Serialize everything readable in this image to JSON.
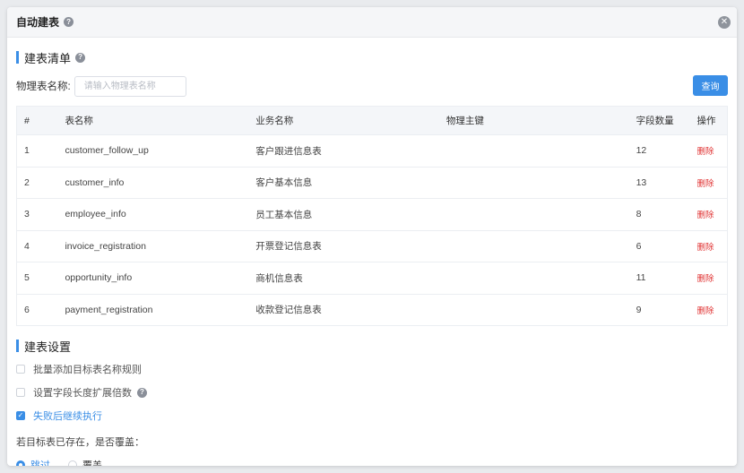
{
  "dialog": {
    "title": "自动建表",
    "help_icon": "question-circle-icon",
    "close_icon": "close-circle-icon"
  },
  "list_section": {
    "title": "建表清单",
    "search_label": "物理表名称:",
    "search_placeholder": "请输入物理表名称",
    "search_value": "",
    "query_label": "查询"
  },
  "table": {
    "headers": [
      "#",
      "表名称",
      "业务名称",
      "物理主键",
      "字段数量",
      "操作"
    ],
    "rows": [
      {
        "idx": "1",
        "name": "customer_follow_up",
        "biz": "客户跟进信息表",
        "pk": "",
        "count": "12",
        "op": "删除"
      },
      {
        "idx": "2",
        "name": "customer_info",
        "biz": "客户基本信息",
        "pk": "",
        "count": "13",
        "op": "删除"
      },
      {
        "idx": "3",
        "name": "employee_info",
        "biz": "员工基本信息",
        "pk": "",
        "count": "8",
        "op": "删除"
      },
      {
        "idx": "4",
        "name": "invoice_registration",
        "biz": "开票登记信息表",
        "pk": "",
        "count": "6",
        "op": "删除"
      },
      {
        "idx": "5",
        "name": "opportunity_info",
        "biz": "商机信息表",
        "pk": "",
        "count": "11",
        "op": "删除"
      },
      {
        "idx": "6",
        "name": "payment_registration",
        "biz": "收款登记信息表",
        "pk": "",
        "count": "9",
        "op": "删除"
      }
    ]
  },
  "settings_section": {
    "title": "建表设置",
    "options": [
      {
        "label": "批量添加目标表名称规则",
        "checked": false
      },
      {
        "label": "设置字段长度扩展倍数",
        "checked": false
      },
      {
        "label": "失败后继续执行",
        "checked": true
      }
    ],
    "overwrite_question": "若目标表已存在，是否覆盖：",
    "radio_skip": "跳过",
    "radio_overwrite": "覆盖",
    "selected": "跳过"
  },
  "colors": {
    "accent": "#3a8ee6",
    "danger": "#e03131"
  }
}
